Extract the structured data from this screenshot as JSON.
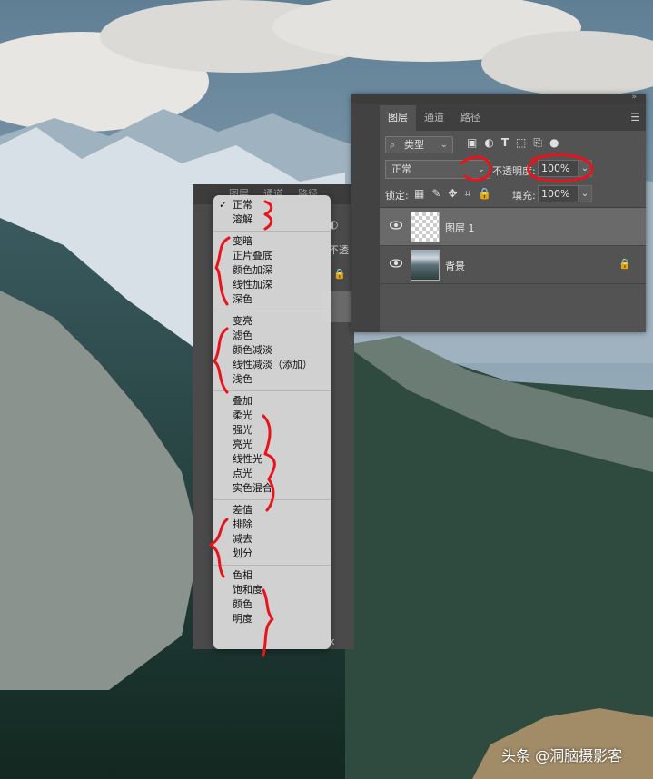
{
  "layers_panel": {
    "tabs": [
      {
        "label": "图层",
        "active": true
      },
      {
        "label": "通道",
        "active": false
      },
      {
        "label": "路径",
        "active": false
      }
    ],
    "filter_label": "类型",
    "blend_mode": "正常",
    "opacity_label": "不透明度:",
    "opacity_value": "100%",
    "lock_label": "锁定:",
    "fill_label": "填充:",
    "fill_value": "100%",
    "layers": [
      {
        "name": "图层 1",
        "selected": true,
        "visible": true,
        "thumb": "transparent"
      },
      {
        "name": "背景",
        "selected": false,
        "visible": true,
        "thumb": "photo",
        "locked": true
      }
    ]
  },
  "back_panel": {
    "tabs": [
      "图层",
      "通道",
      "路径"
    ],
    "opacity_fragment": "不透",
    "fragment_x": "x"
  },
  "blend_menu": {
    "selected": "正常",
    "groups": [
      [
        "正常",
        "溶解"
      ],
      [
        "变暗",
        "正片叠底",
        "颜色加深",
        "线性加深",
        "深色"
      ],
      [
        "变亮",
        "滤色",
        "颜色减淡",
        "线性减淡（添加）",
        "浅色"
      ],
      [
        "叠加",
        "柔光",
        "强光",
        "亮光",
        "线性光",
        "点光",
        "实色混合"
      ],
      [
        "差值",
        "排除",
        "减去",
        "划分"
      ],
      [
        "色相",
        "饱和度",
        "颜色",
        "明度"
      ]
    ]
  },
  "watermark": "头条 @洞脑摄影客",
  "colors": {
    "panel": "#535353",
    "annotation": "#e8141c"
  }
}
